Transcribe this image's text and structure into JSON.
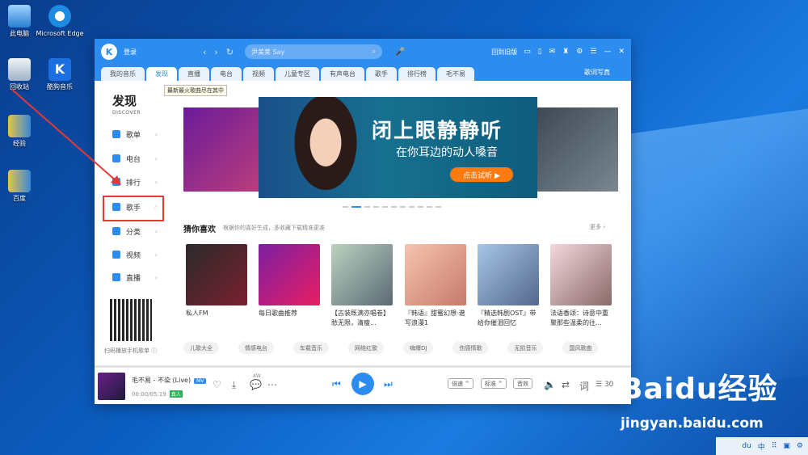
{
  "desktop": {
    "icons": [
      {
        "label": "此电脑"
      },
      {
        "label": "Microsoft Edge"
      },
      {
        "label": "回收站"
      },
      {
        "label": "酷狗音乐"
      },
      {
        "label": "经验"
      },
      {
        "label": "百度"
      }
    ],
    "watermark": {
      "brand": "Baidu经验",
      "url": "jingyan.baidu.com"
    },
    "taskbar": [
      "du",
      "中",
      "⠿",
      "▣",
      "⚙"
    ]
  },
  "app": {
    "logo": "K",
    "login": "登录",
    "search_placeholder": "尹美莱 Say",
    "old_version": "回到旧版",
    "tabs": [
      "我的音乐",
      "发现",
      "直播",
      "电台",
      "视频",
      "儿童专区",
      "有声电台",
      "歌手",
      "排行榜",
      "毛不易"
    ],
    "active_tab": "发现",
    "lyrics_label": "歌词写真",
    "tooltip": "最新最火歌曲尽在其中",
    "sidebar": {
      "heading": "发现",
      "heading_en": "DISCOVER",
      "items": [
        {
          "label": "歌单",
          "icon": "playlist-icon"
        },
        {
          "label": "电台",
          "icon": "radio-icon"
        },
        {
          "label": "排行",
          "icon": "rank-icon"
        },
        {
          "label": "歌手",
          "icon": "singer-icon"
        },
        {
          "label": "分类",
          "icon": "category-icon"
        },
        {
          "label": "视频",
          "icon": "video-icon"
        },
        {
          "label": "直播",
          "icon": "live-icon"
        }
      ],
      "qr_caption": "扫码播放手机歌单"
    },
    "banner": {
      "title": "闭上眼静静听",
      "subtitle": "在你耳边的动人嗓音",
      "cta": "点击试听 ▶"
    },
    "guess": {
      "title": "猜你喜欢",
      "subtitle": "根据你的喜好生成，多收藏下载精准更准",
      "more": "更多 ›",
      "cards": [
        {
          "label": "私人FM"
        },
        {
          "label": "每日歌曲推荐"
        },
        {
          "label": "【古装既满亦唱卷】愁无限，清瘦..."
        },
        {
          "label": "『韩语』甜蜜幻想·谱写浪漫1"
        },
        {
          "label": "『精选韩剧OST』带给你催泪回忆"
        },
        {
          "label": "法语香颂：诗意中重聚那些温柔的往..."
        }
      ]
    },
    "tags": [
      "儿歌大全",
      "情感电台",
      "车载音乐",
      "网络红歌",
      "嗨爆DJ",
      "伤感情歌",
      "无损音乐",
      "国风歌曲"
    ],
    "player": {
      "song": "毛不易 - 不染 (Live)",
      "mv": "MV",
      "time": "00:00/05:19",
      "original": "真人",
      "count_badge": "4W",
      "play": "▶",
      "prev": "⏮",
      "next": "⏭",
      "speed": "倍速 ^",
      "quality": "标准 ^",
      "sound": "音效",
      "lyrics_btn": "词",
      "playlist_count": "30",
      "progress": 0.0
    }
  }
}
